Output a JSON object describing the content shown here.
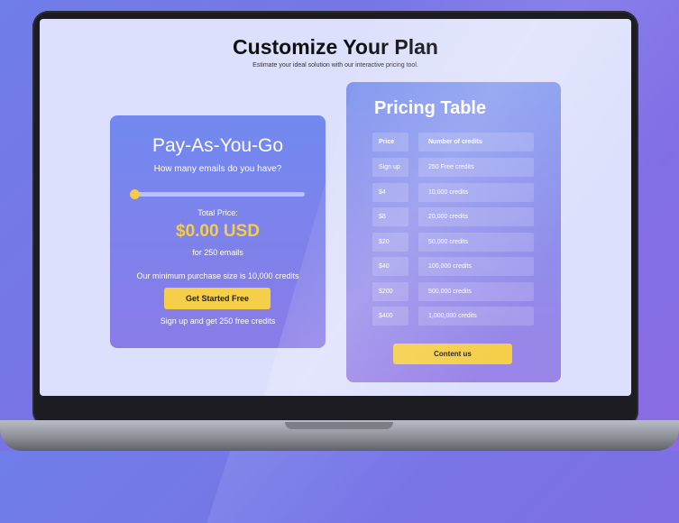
{
  "page": {
    "title": "Customize Your Plan",
    "subtitle": "Estimate your ideal solution with our interactive pricing tool."
  },
  "payg": {
    "title": "Pay-As-You-Go",
    "question": "How many emails do you have?",
    "slider_value_fraction": 0.0,
    "total_label": "Total Price:",
    "price": "$0.00 USD",
    "for_emails": "for 250 emails",
    "min_purchase": "Our minimum purchase size is 10,000 credits",
    "cta_label": "Get Started Free",
    "signup_note": "Sign up and get 250 free credits"
  },
  "pricing": {
    "title": "Pricing Table",
    "headers": {
      "price": "Price",
      "credits": "Number of credits"
    },
    "rows": [
      {
        "price": "Sign up",
        "credits": "250 Free credits"
      },
      {
        "price": "$4",
        "credits": "10,000 credits"
      },
      {
        "price": "$8",
        "credits": "20,000 credits"
      },
      {
        "price": "$20",
        "credits": "50,000 credits"
      },
      {
        "price": "$40",
        "credits": "100,000 credits"
      },
      {
        "price": "$200",
        "credits": "500,000 credits"
      },
      {
        "price": "$400",
        "credits": "1,000,000 credits"
      }
    ],
    "contact_label": "Content us"
  },
  "colors": {
    "accent_yellow": "#f5cf4a",
    "card_blue": "#7189ef",
    "card_purple": "#8a7be8"
  }
}
